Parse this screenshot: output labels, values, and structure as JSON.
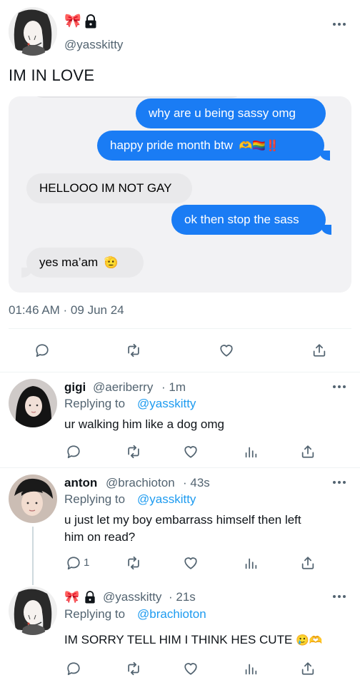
{
  "main_tweet": {
    "handle": "@yasskitty",
    "badge_emoji": "🎀",
    "text": "IM IN LOVE",
    "timestamp": "01:46 AM · 09 Jun 24",
    "image": {
      "messages": [
        {
          "side": "out",
          "text": "why are u being sassy omg"
        },
        {
          "side": "out",
          "text": "happy pride month btw",
          "emoji": "🫶🏳️‍🌈‼️"
        },
        {
          "side": "in",
          "text": "HELLOOO IM NOT GAY"
        },
        {
          "side": "out",
          "text": "ok then stop the sass"
        },
        {
          "side": "in",
          "text": "yes ma’am",
          "emoji": "🫡"
        }
      ]
    }
  },
  "replies": [
    {
      "name": "gigi",
      "handle": "@aeriberry",
      "time": "· 1m",
      "replying_prefix": "Replying to",
      "replying_to": "@yasskitty",
      "text": "ur walking him like a dog omg",
      "reply_count": ""
    },
    {
      "name": "anton",
      "handle": "@brachioton",
      "time": "· 43s",
      "replying_prefix": "Replying to",
      "replying_to": "@yasskitty",
      "text_line1": "u just let my boy embarrass himself then left",
      "text_line2": "him on read?",
      "reply_count": "1"
    },
    {
      "badge_emoji": "🎀",
      "handle": "@yasskitty",
      "time": "· 21s",
      "replying_prefix": "Replying to",
      "replying_to": "@brachioton",
      "text": "IM SORRY TELL HIM I THINK HES CUTE",
      "emoji": "🥲🫶"
    }
  ],
  "colors": {
    "accent": "#1d9bf0",
    "imessage_blue": "#1a7cf4",
    "imessage_gray": "#e9e9eb",
    "secondary_text": "#536471"
  }
}
